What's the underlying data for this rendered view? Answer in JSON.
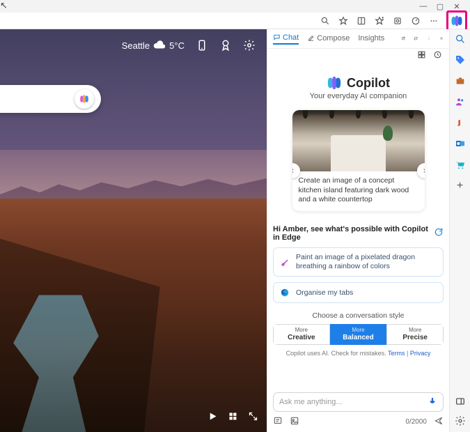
{
  "window": {
    "minimize": "—",
    "maximize": "▢",
    "close": "✕"
  },
  "toolbar": {
    "icons": [
      "zoom",
      "favorite",
      "collections",
      "extensions",
      "screenshot",
      "performance",
      "more"
    ]
  },
  "ntp": {
    "city": "Seattle",
    "temp": "5°C",
    "icons": [
      "phone",
      "rewards",
      "settings"
    ],
    "media": [
      "play",
      "switch-bg",
      "expand"
    ]
  },
  "panel": {
    "tabs": {
      "chat": "Chat",
      "compose": "Compose",
      "insights": "Insights"
    },
    "brand_title": "Copilot",
    "brand_sub": "Your everyday AI companion",
    "card_prompt": "Create an image of a concept kitchen island featuring dark wood and a white countertop",
    "greeting": "Hi Amber, see what's possible with Copilot in Edge",
    "suggestions": [
      "Paint an image of a pixelated dragon breathing a rainbow of colors",
      "Organise my tabs"
    ],
    "style_label": "Choose a conversation style",
    "styles": {
      "more": "More",
      "creative": "Creative",
      "balanced": "Balanced",
      "precise": "Precise"
    },
    "disclaimer_pre": "Copilot uses AI. Check for mistakes. ",
    "terms": "Terms",
    "sep": " | ",
    "privacy": "Privacy",
    "ask_placeholder": "Ask me anything...",
    "char_count": "0/2000"
  },
  "sidebar": {
    "items": [
      "search",
      "tag",
      "briefcase",
      "people",
      "office",
      "outlook",
      "shopping"
    ]
  }
}
